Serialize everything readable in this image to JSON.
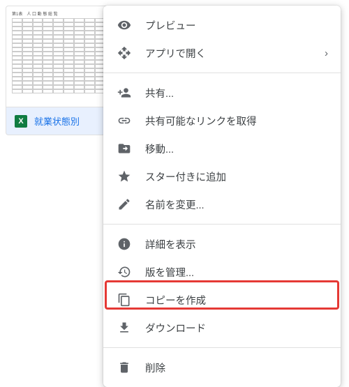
{
  "thumbnail": {
    "sheet_title": "第1表　人 口 動 態 総 覧",
    "file_name": "就業状態別"
  },
  "menu": {
    "preview": "プレビュー",
    "open_with": "アプリで開く",
    "share": "共有...",
    "get_link": "共有可能なリンクを取得",
    "move": "移動...",
    "star": "スター付きに追加",
    "rename": "名前を変更...",
    "details": "詳細を表示",
    "versions": "版を管理...",
    "copy": "コピーを作成",
    "download": "ダウンロード",
    "delete": "削除"
  },
  "colors": {
    "highlight": "#e53935"
  }
}
